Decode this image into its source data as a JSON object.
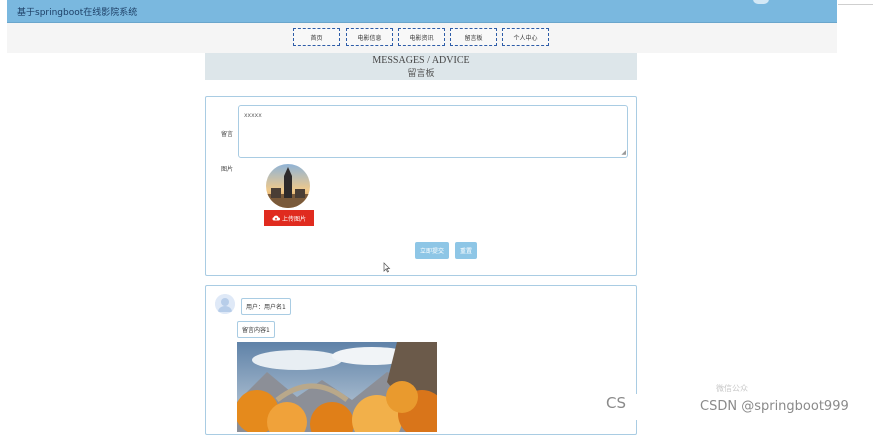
{
  "app": {
    "title": "基于springboot在线影院系统"
  },
  "nav": {
    "items": [
      "首页",
      "电影信息",
      "电影资讯",
      "留言板",
      "个人中心"
    ]
  },
  "page_header": {
    "title_en": "MESSAGES / ADVICE",
    "title_cn": "留言板"
  },
  "form": {
    "message_label": "留言",
    "message_value": "xxxxx",
    "image_label": "图片",
    "upload_label": "上传图片",
    "submit_label": "立即提交",
    "reset_label": "重置"
  },
  "comment": {
    "user_label": "用户：用户名1",
    "content_label": "留言内容1"
  },
  "watermark": {
    "left": "CS",
    "right": "CSDN @springboot999",
    "faint": "微信公众"
  },
  "colors": {
    "header": "#7ab8df",
    "upload": "#e02b1f",
    "button": "#8ec6e6",
    "border": "#a9cce3"
  }
}
